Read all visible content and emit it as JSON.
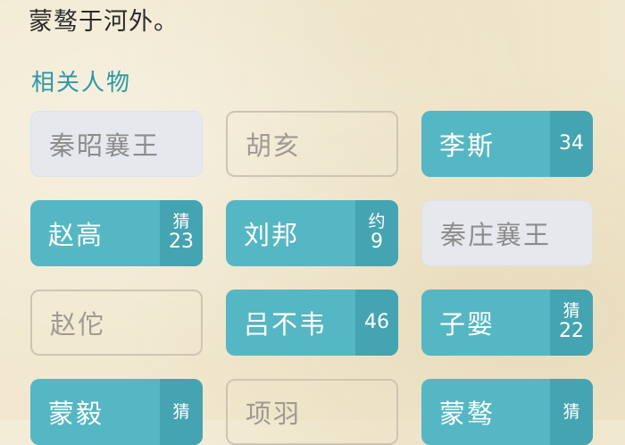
{
  "top_text": "蒙骜于河外。",
  "section_title": "相关人物",
  "people": [
    {
      "name": "秦昭襄王",
      "style": "plain",
      "tag": "",
      "count": ""
    },
    {
      "name": "胡亥",
      "style": "outline",
      "tag": "",
      "count": ""
    },
    {
      "name": "李斯",
      "style": "active",
      "tag": "",
      "count": "34"
    },
    {
      "name": "赵高",
      "style": "active",
      "tag": "猜",
      "count": "23"
    },
    {
      "name": "刘邦",
      "style": "active",
      "tag": "约",
      "count": "9"
    },
    {
      "name": "秦庄襄王",
      "style": "plain",
      "tag": "",
      "count": ""
    },
    {
      "name": "赵佗",
      "style": "outline",
      "tag": "",
      "count": ""
    },
    {
      "name": "吕不韦",
      "style": "active",
      "tag": "",
      "count": "46"
    },
    {
      "name": "子婴",
      "style": "active",
      "tag": "猜",
      "count": "22"
    },
    {
      "name": "蒙毅",
      "style": "active",
      "tag": "猜",
      "count": ""
    },
    {
      "name": "项羽",
      "style": "outline",
      "tag": "",
      "count": ""
    },
    {
      "name": "蒙骜",
      "style": "active",
      "tag": "猜",
      "count": ""
    }
  ],
  "colors": {
    "accent": "#55b7c3",
    "badge": "#45a4b1",
    "section_title": "#2f97a8",
    "background": "#f1e8cf"
  }
}
